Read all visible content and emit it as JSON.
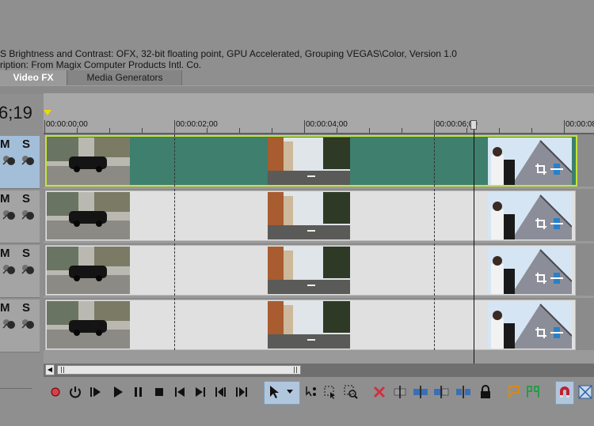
{
  "plugin_info": {
    "line1": "S Brightness and Contrast: OFX, 32-bit floating point, GPU Accelerated, Grouping VEGAS\\Color, Version 1.0",
    "line2": "ription: From Magix Computer Products Intl. Co."
  },
  "tabs": [
    {
      "label": "Video FX",
      "active": true
    },
    {
      "label": "Media Generators",
      "active": false
    }
  ],
  "timecode": "6;19",
  "ruler": {
    "labels": [
      "00:00:00;00",
      "00:00:02;00",
      "00:00:04;00",
      "00:00:06;00",
      "00:00:08"
    ]
  },
  "tracks": [
    {
      "mute": "M",
      "solo": "S",
      "selected": true
    },
    {
      "mute": "M",
      "solo": "S",
      "selected": false
    },
    {
      "mute": "M",
      "solo": "S",
      "selected": false
    },
    {
      "mute": "M",
      "solo": "S",
      "selected": false
    }
  ],
  "toolbar": {
    "icons": [
      "record-icon",
      "loop-icon",
      "play-from-start-icon",
      "play-icon",
      "pause-icon",
      "stop-icon",
      "go-to-start-icon",
      "go-to-end-icon",
      "previous-frame-icon",
      "next-frame-icon",
      "normal-edit-tool-icon",
      "envelope-tool-icon",
      "selection-tool-icon",
      "zoom-tool-icon",
      "delete-icon",
      "trim-icon",
      "trim-start-icon",
      "trim-end-icon",
      "split-icon",
      "lock-icon",
      "marker-icon",
      "region-icon",
      "snapping-icon",
      "auto-ripple-icon"
    ]
  },
  "colors": {
    "selected_track_fill": "#3e7f6e",
    "selected_track_border": "#c5e43a",
    "track_fill": "#e0e0e0",
    "accent_blue": "#3a6fb8",
    "delete_red": "#d03040"
  }
}
